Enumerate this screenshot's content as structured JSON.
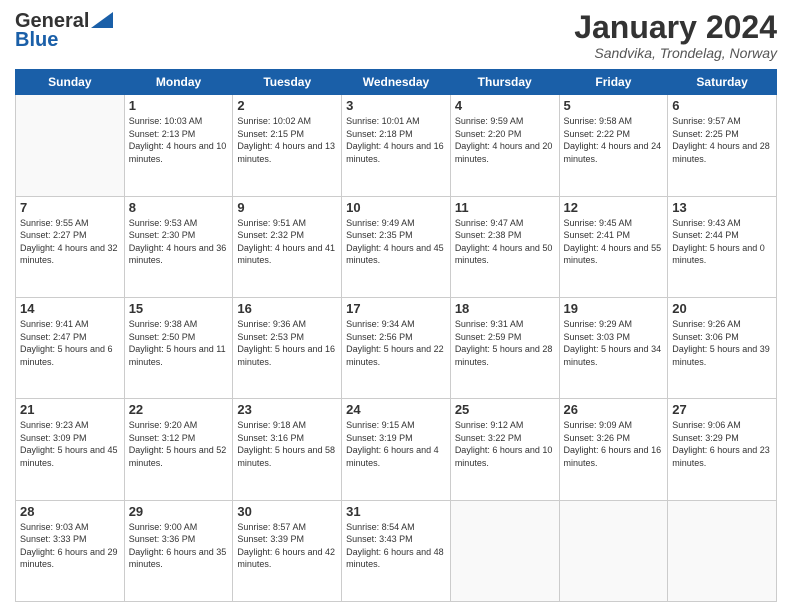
{
  "header": {
    "logo_line1": "General",
    "logo_line2": "Blue",
    "month": "January 2024",
    "location": "Sandvika, Trondelag, Norway"
  },
  "weekdays": [
    "Sunday",
    "Monday",
    "Tuesday",
    "Wednesday",
    "Thursday",
    "Friday",
    "Saturday"
  ],
  "weeks": [
    [
      {
        "day": "",
        "sunrise": "",
        "sunset": "",
        "daylight": ""
      },
      {
        "day": "1",
        "sunrise": "Sunrise: 10:03 AM",
        "sunset": "Sunset: 2:13 PM",
        "daylight": "Daylight: 4 hours and 10 minutes."
      },
      {
        "day": "2",
        "sunrise": "Sunrise: 10:02 AM",
        "sunset": "Sunset: 2:15 PM",
        "daylight": "Daylight: 4 hours and 13 minutes."
      },
      {
        "day": "3",
        "sunrise": "Sunrise: 10:01 AM",
        "sunset": "Sunset: 2:18 PM",
        "daylight": "Daylight: 4 hours and 16 minutes."
      },
      {
        "day": "4",
        "sunrise": "Sunrise: 9:59 AM",
        "sunset": "Sunset: 2:20 PM",
        "daylight": "Daylight: 4 hours and 20 minutes."
      },
      {
        "day": "5",
        "sunrise": "Sunrise: 9:58 AM",
        "sunset": "Sunset: 2:22 PM",
        "daylight": "Daylight: 4 hours and 24 minutes."
      },
      {
        "day": "6",
        "sunrise": "Sunrise: 9:57 AM",
        "sunset": "Sunset: 2:25 PM",
        "daylight": "Daylight: 4 hours and 28 minutes."
      }
    ],
    [
      {
        "day": "7",
        "sunrise": "Sunrise: 9:55 AM",
        "sunset": "Sunset: 2:27 PM",
        "daylight": "Daylight: 4 hours and 32 minutes."
      },
      {
        "day": "8",
        "sunrise": "Sunrise: 9:53 AM",
        "sunset": "Sunset: 2:30 PM",
        "daylight": "Daylight: 4 hours and 36 minutes."
      },
      {
        "day": "9",
        "sunrise": "Sunrise: 9:51 AM",
        "sunset": "Sunset: 2:32 PM",
        "daylight": "Daylight: 4 hours and 41 minutes."
      },
      {
        "day": "10",
        "sunrise": "Sunrise: 9:49 AM",
        "sunset": "Sunset: 2:35 PM",
        "daylight": "Daylight: 4 hours and 45 minutes."
      },
      {
        "day": "11",
        "sunrise": "Sunrise: 9:47 AM",
        "sunset": "Sunset: 2:38 PM",
        "daylight": "Daylight: 4 hours and 50 minutes."
      },
      {
        "day": "12",
        "sunrise": "Sunrise: 9:45 AM",
        "sunset": "Sunset: 2:41 PM",
        "daylight": "Daylight: 4 hours and 55 minutes."
      },
      {
        "day": "13",
        "sunrise": "Sunrise: 9:43 AM",
        "sunset": "Sunset: 2:44 PM",
        "daylight": "Daylight: 5 hours and 0 minutes."
      }
    ],
    [
      {
        "day": "14",
        "sunrise": "Sunrise: 9:41 AM",
        "sunset": "Sunset: 2:47 PM",
        "daylight": "Daylight: 5 hours and 6 minutes."
      },
      {
        "day": "15",
        "sunrise": "Sunrise: 9:38 AM",
        "sunset": "Sunset: 2:50 PM",
        "daylight": "Daylight: 5 hours and 11 minutes."
      },
      {
        "day": "16",
        "sunrise": "Sunrise: 9:36 AM",
        "sunset": "Sunset: 2:53 PM",
        "daylight": "Daylight: 5 hours and 16 minutes."
      },
      {
        "day": "17",
        "sunrise": "Sunrise: 9:34 AM",
        "sunset": "Sunset: 2:56 PM",
        "daylight": "Daylight: 5 hours and 22 minutes."
      },
      {
        "day": "18",
        "sunrise": "Sunrise: 9:31 AM",
        "sunset": "Sunset: 2:59 PM",
        "daylight": "Daylight: 5 hours and 28 minutes."
      },
      {
        "day": "19",
        "sunrise": "Sunrise: 9:29 AM",
        "sunset": "Sunset: 3:03 PM",
        "daylight": "Daylight: 5 hours and 34 minutes."
      },
      {
        "day": "20",
        "sunrise": "Sunrise: 9:26 AM",
        "sunset": "Sunset: 3:06 PM",
        "daylight": "Daylight: 5 hours and 39 minutes."
      }
    ],
    [
      {
        "day": "21",
        "sunrise": "Sunrise: 9:23 AM",
        "sunset": "Sunset: 3:09 PM",
        "daylight": "Daylight: 5 hours and 45 minutes."
      },
      {
        "day": "22",
        "sunrise": "Sunrise: 9:20 AM",
        "sunset": "Sunset: 3:12 PM",
        "daylight": "Daylight: 5 hours and 52 minutes."
      },
      {
        "day": "23",
        "sunrise": "Sunrise: 9:18 AM",
        "sunset": "Sunset: 3:16 PM",
        "daylight": "Daylight: 5 hours and 58 minutes."
      },
      {
        "day": "24",
        "sunrise": "Sunrise: 9:15 AM",
        "sunset": "Sunset: 3:19 PM",
        "daylight": "Daylight: 6 hours and 4 minutes."
      },
      {
        "day": "25",
        "sunrise": "Sunrise: 9:12 AM",
        "sunset": "Sunset: 3:22 PM",
        "daylight": "Daylight: 6 hours and 10 minutes."
      },
      {
        "day": "26",
        "sunrise": "Sunrise: 9:09 AM",
        "sunset": "Sunset: 3:26 PM",
        "daylight": "Daylight: 6 hours and 16 minutes."
      },
      {
        "day": "27",
        "sunrise": "Sunrise: 9:06 AM",
        "sunset": "Sunset: 3:29 PM",
        "daylight": "Daylight: 6 hours and 23 minutes."
      }
    ],
    [
      {
        "day": "28",
        "sunrise": "Sunrise: 9:03 AM",
        "sunset": "Sunset: 3:33 PM",
        "daylight": "Daylight: 6 hours and 29 minutes."
      },
      {
        "day": "29",
        "sunrise": "Sunrise: 9:00 AM",
        "sunset": "Sunset: 3:36 PM",
        "daylight": "Daylight: 6 hours and 35 minutes."
      },
      {
        "day": "30",
        "sunrise": "Sunrise: 8:57 AM",
        "sunset": "Sunset: 3:39 PM",
        "daylight": "Daylight: 6 hours and 42 minutes."
      },
      {
        "day": "31",
        "sunrise": "Sunrise: 8:54 AM",
        "sunset": "Sunset: 3:43 PM",
        "daylight": "Daylight: 6 hours and 48 minutes."
      },
      {
        "day": "",
        "sunrise": "",
        "sunset": "",
        "daylight": ""
      },
      {
        "day": "",
        "sunrise": "",
        "sunset": "",
        "daylight": ""
      },
      {
        "day": "",
        "sunrise": "",
        "sunset": "",
        "daylight": ""
      }
    ]
  ]
}
